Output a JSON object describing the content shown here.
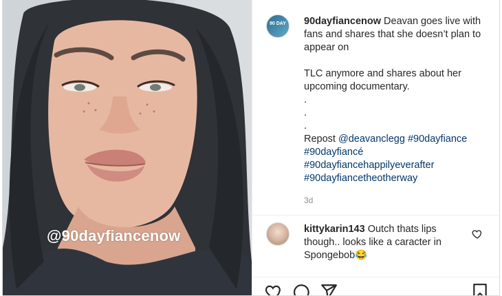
{
  "post": {
    "watermark": "@90dayfiancenow",
    "author": "90dayfiancenow",
    "avatar_text": "90 DAY",
    "caption_line1": "Deavan goes live with fans and shares that she doesn’t plan to appear on",
    "caption_line2": "TLC anymore and shares about her upcoming documentary.",
    "dots": [
      ".",
      ".",
      "."
    ],
    "repost_prefix": "Repost ",
    "repost_user": "@deavanclegg",
    "hashtags": [
      "#90dayfiance",
      "#90dayfiancé",
      "#90dayfiancehappilyeverafter",
      "#90dayfiancetheotherway"
    ],
    "time_ago": "3d"
  },
  "comment": {
    "user": "kittykarin143",
    "text": "Outch thats lips though.. looks like a caracter in Spongebob😂"
  },
  "icons": {
    "like": "heart-icon",
    "comment": "comment-icon",
    "share": "send-icon",
    "save": "bookmark-icon"
  }
}
